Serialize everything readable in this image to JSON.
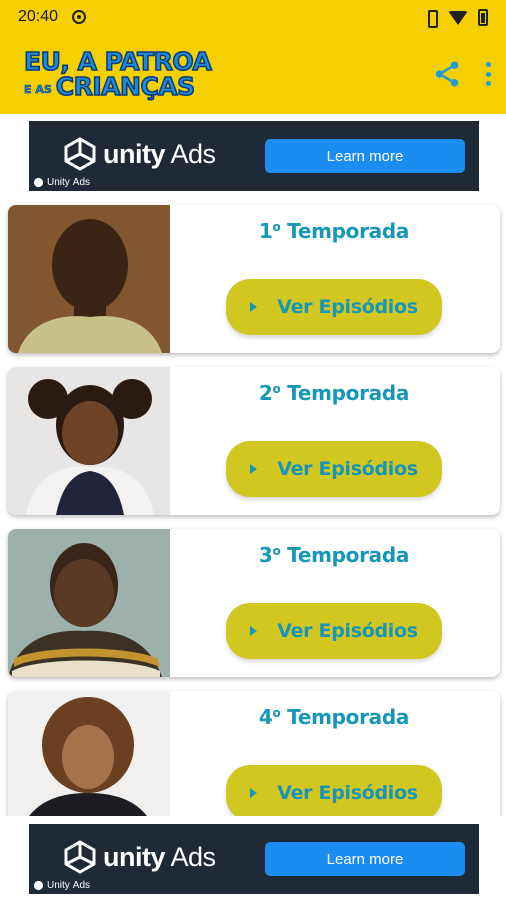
{
  "status_bar": {
    "time": "20:40"
  },
  "app_bar": {
    "logo_line1": "EU, A PATROA",
    "logo_small": "E AS",
    "logo_line2": "CRIANÇAS",
    "share_icon": "share-icon",
    "more_icon": "more-vert-icon"
  },
  "ad_top": {
    "brand": "unity",
    "brand_suffix": "Ads",
    "cta": "Learn more",
    "mini_brand": "Unity",
    "mini_suffix": "Ads"
  },
  "seasons": [
    {
      "number": "1",
      "sup": "o",
      "label": "Temporada",
      "button": "Ver Episódios"
    },
    {
      "number": "2",
      "sup": "o",
      "label": "Temporada",
      "button": "Ver Episódios"
    },
    {
      "number": "3",
      "sup": "o",
      "label": "Temporada",
      "button": "Ver Episódios"
    },
    {
      "number": "4",
      "sup": "o",
      "label": "Temporada",
      "button": "Ver Episódios"
    }
  ],
  "ad_bottom": {
    "brand": "unity",
    "brand_suffix": "Ads",
    "cta": "Learn more",
    "mini_brand": "Unity",
    "mini_suffix": "Ads"
  },
  "colors": {
    "app_bar": "#f4d000",
    "accent_text": "#1796b8",
    "button": "#d2c620",
    "ad_bg": "#1f2a36",
    "ad_cta": "#1a8cf2"
  }
}
